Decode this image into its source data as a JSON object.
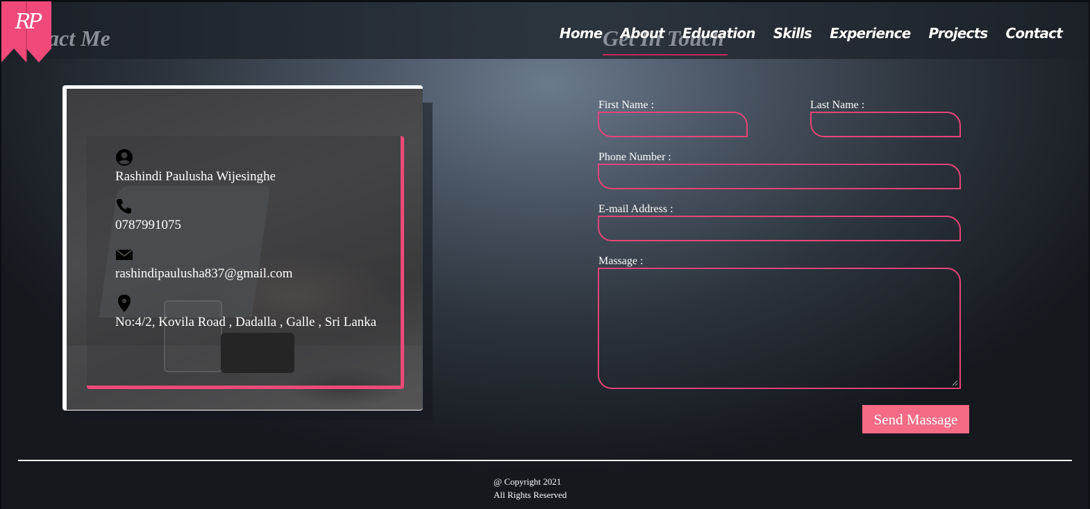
{
  "brand": {
    "logo_text": "RP",
    "accent_color": "#f0497a"
  },
  "nav": {
    "items": [
      {
        "label": "Home"
      },
      {
        "label": "About"
      },
      {
        "label": "Education"
      },
      {
        "label": "Skills"
      },
      {
        "label": "Experience"
      },
      {
        "label": "Projects"
      },
      {
        "label": "Contact"
      }
    ]
  },
  "sections": {
    "contact_title": "Contact Me",
    "getin_title": "Get In Touch"
  },
  "contact_info": {
    "name": {
      "icon": "user-icon",
      "value": "Rashindi Paulusha Wijesinghe"
    },
    "phone": {
      "icon": "phone-icon",
      "value": "0787991075"
    },
    "email": {
      "icon": "mail-icon",
      "value": "rashindipaulusha837@gmail.com"
    },
    "address": {
      "icon": "location-pin-icon",
      "value": "No:4/2, Kovila Road , Dadalla , Galle , Sri Lanka"
    }
  },
  "form": {
    "first_name_label": "First Name :",
    "last_name_label": "Last Name :",
    "phone_label": "Phone Number :",
    "email_label": "E-mail Address :",
    "message_label": "Massage :",
    "submit_label": "Send Massage"
  },
  "footer": {
    "copyright": "@ Copyright 2021",
    "rights": "All Rights Reserved"
  }
}
